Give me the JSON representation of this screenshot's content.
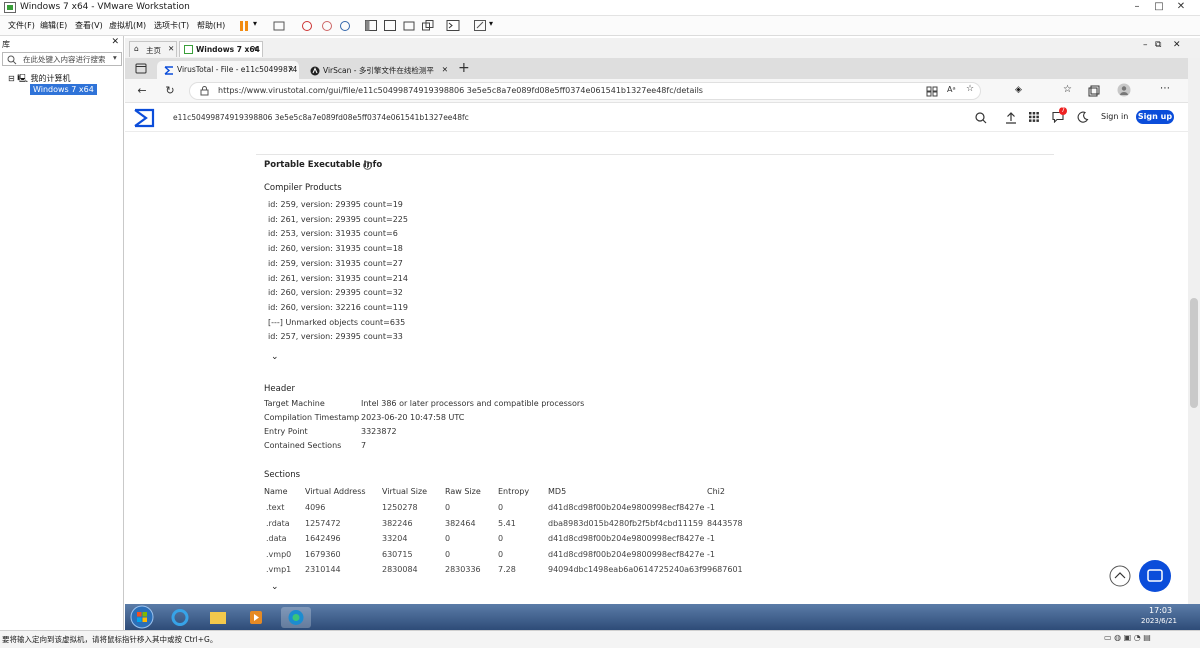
{
  "vmware": {
    "title": "Windows 7 x64 - VMware Workstation",
    "menu": [
      "文件(F)",
      "编辑(E)",
      "查看(V)",
      "虚拟机(M)",
      "选项卡(T)",
      "帮助(H)"
    ],
    "library": {
      "header": "库",
      "search_placeholder": "在此处键入内容进行搜索",
      "tree_root": "我的计算机",
      "tree_vm": "Windows 7 x64"
    },
    "tabs": [
      "主页",
      "Windows 7 x64"
    ],
    "status": "要将输入定向到该虚拟机，请将鼠标指针移入其中或按 Ctrl+G。"
  },
  "browser": {
    "tabs": [
      {
        "label": "VirusTotal - File - e11c50499874"
      },
      {
        "label": "VirScan - 多引擎文件在线检测平"
      }
    ],
    "url": "https://www.virustotal.com/gui/file/e11c50499874919398806 3e5e5c8a7e089fd08e5ff0374e061541b1327ee48fc/details"
  },
  "vt": {
    "hash": "e11c50499874919398806 3e5e5c8a7e089fd08e5ff0374e061541b1327ee48fc",
    "sign_in": "Sign in",
    "sign_up": "Sign up",
    "notification_count": "7",
    "pe_title": "Portable Executable Info",
    "compiler_title": "Compiler Products",
    "compiler_products": [
      "id: 259, version: 29395 count=19",
      "id: 261, version: 29395 count=225",
      "id: 253, version: 31935 count=6",
      "id: 260, version: 31935 count=18",
      "id: 259, version: 31935 count=27",
      "id: 261, version: 31935 count=214",
      "id: 260, version: 29395 count=32",
      "id: 260, version: 32216 count=119",
      "[---] Unmarked objects count=635",
      "id: 257, version: 29395 count=33"
    ],
    "header_title": "Header",
    "header": [
      {
        "label": "Target Machine",
        "value": "Intel 386 or later processors and compatible processors"
      },
      {
        "label": "Compilation Timestamp",
        "value": "2023-06-20 10:47:58 UTC"
      },
      {
        "label": "Entry Point",
        "value": "3323872"
      },
      {
        "label": "Contained Sections",
        "value": "7"
      }
    ],
    "sections_title": "Sections",
    "sections_columns": [
      "Name",
      "Virtual Address",
      "Virtual Size",
      "Raw Size",
      "Entropy",
      "MD5",
      "Chi2"
    ],
    "sections_rows": [
      [
        ".text",
        "4096",
        "1250278",
        "0",
        "0",
        "d41d8cd98f00b204e9800998ecf8427e",
        "-1"
      ],
      [
        ".rdata",
        "1257472",
        "382246",
        "382464",
        "5.41",
        "dba8983d015b4280fb2f5bf4cbd11159",
        "8443578"
      ],
      [
        ".data",
        "1642496",
        "33204",
        "0",
        "0",
        "d41d8cd98f00b204e9800998ecf8427e",
        "-1"
      ],
      [
        ".vmp0",
        "1679360",
        "630715",
        "0",
        "0",
        "d41d8cd98f00b204e9800998ecf8427e",
        "-1"
      ],
      [
        ".vmp1",
        "2310144",
        "2830084",
        "2830336",
        "7.28",
        "94094dbc1498eab6a0614725240a63f9",
        "9687601"
      ]
    ]
  },
  "taskbar": {
    "time": "17:03",
    "date": "2023/6/21"
  },
  "colors": {
    "accent": "#0b4dda",
    "vt_logo": "#0b4dda"
  }
}
